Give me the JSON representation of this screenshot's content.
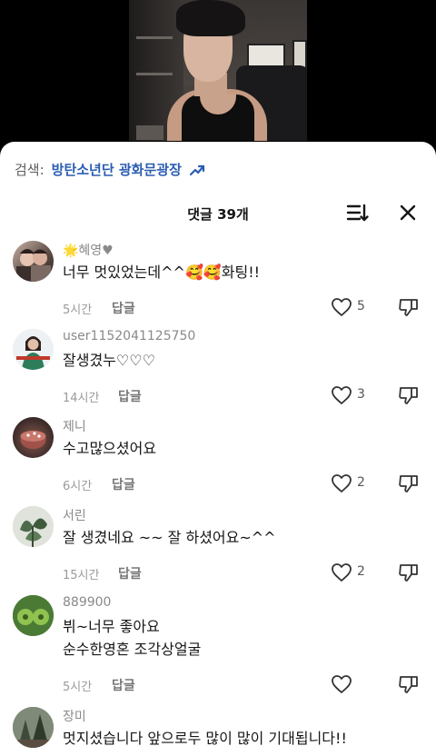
{
  "search": {
    "prefix": "검색:",
    "query": "방탄소년단 광화문광장"
  },
  "header": {
    "title": "댓글 39개"
  },
  "comments": [
    {
      "user": "🌟혜영♥",
      "lines": [
        "너무 멋있었는데^^🥰🥰화팅!!"
      ],
      "time": "5시간",
      "reply": "답글",
      "likes": "5"
    },
    {
      "user": "user1152041125750",
      "lines": [
        "잘생겼누♡♡♡"
      ],
      "time": "14시간",
      "reply": "답글",
      "likes": "3"
    },
    {
      "user": "제니",
      "lines": [
        "수고많으셨어요"
      ],
      "time": "6시간",
      "reply": "답글",
      "likes": "2"
    },
    {
      "user": "서린",
      "lines": [
        "잘 생겼네요 ~~ 잘 하셨어요~^^"
      ],
      "time": "15시간",
      "reply": "답글",
      "likes": "2"
    },
    {
      "user": "889900",
      "lines": [
        "뷔~너무 좋아요",
        "순수한영혼 조각상얼굴"
      ],
      "time": "5시간",
      "reply": "답글",
      "likes": ""
    },
    {
      "user": "장미",
      "lines": [
        "멋지셨습니다 앞으로두 많이 많이 기대됩니다!!"
      ],
      "time": "",
      "reply": "",
      "likes": ""
    }
  ],
  "colors": {
    "link": "#2a5db0",
    "text": "#161616",
    "muted": "#9a9a9a"
  }
}
